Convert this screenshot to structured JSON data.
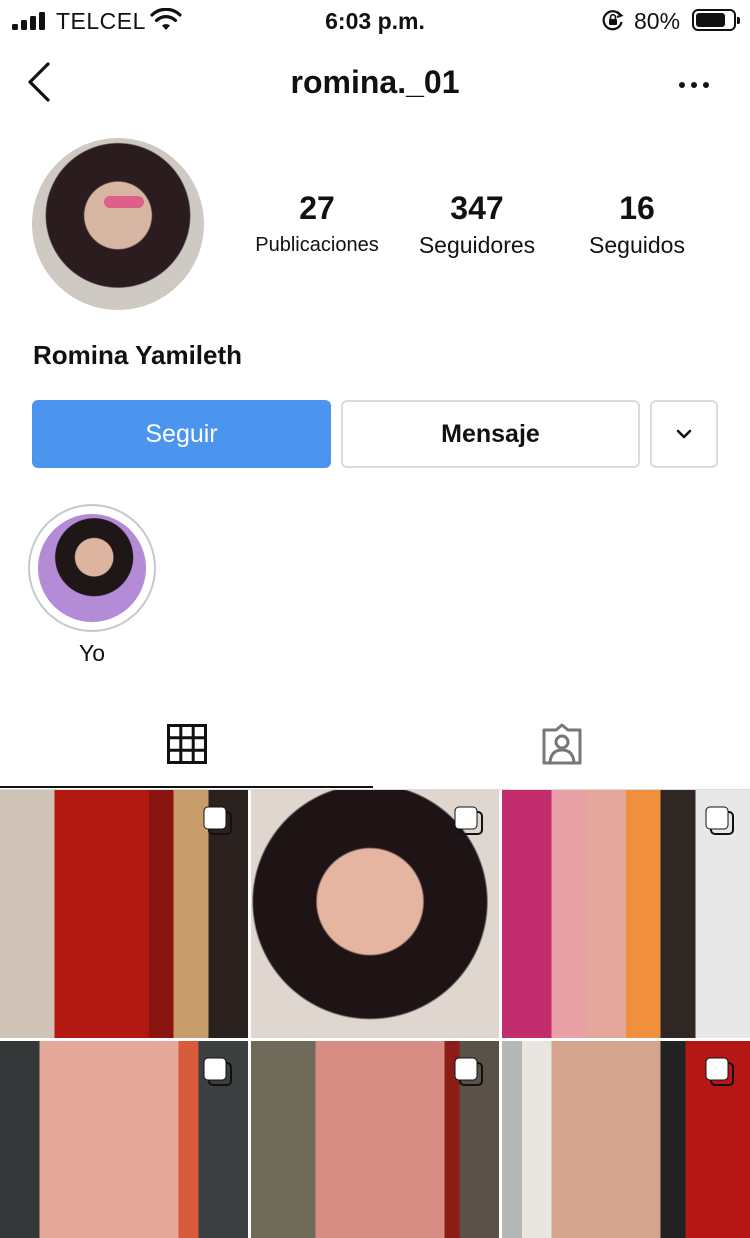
{
  "status_bar": {
    "carrier": "TELCEL",
    "time": "6:03 p.m.",
    "battery_percent": "80%",
    "battery_level": 0.8,
    "icons": [
      "signal-icon",
      "wifi-icon",
      "orientation-lock-icon",
      "battery-icon"
    ]
  },
  "header": {
    "username": "romina._01",
    "icons": [
      "back-chevron-icon",
      "more-options-icon"
    ]
  },
  "profile": {
    "full_name": "Romina Yamileth",
    "stats": [
      {
        "value": "27",
        "label": "Publicaciones"
      },
      {
        "value": "347",
        "label": "Seguidores"
      },
      {
        "value": "16",
        "label": "Seguidos"
      }
    ]
  },
  "actions": {
    "follow_label": "Seguir",
    "message_label": "Mensaje",
    "follow_color": "#4b95ee"
  },
  "highlights": [
    {
      "label": "Yo"
    }
  ],
  "tabs": [
    {
      "name": "grid",
      "icon": "grid-icon",
      "active": true
    },
    {
      "name": "tagged",
      "icon": "tagged-person-icon",
      "active": false
    }
  ],
  "posts": [
    {
      "type": "carousel",
      "icon": "multiple-photos-icon"
    },
    {
      "type": "carousel",
      "icon": "multiple-photos-icon"
    },
    {
      "type": "carousel",
      "icon": "multiple-photos-icon"
    },
    {
      "type": "carousel",
      "icon": "multiple-photos-icon"
    },
    {
      "type": "carousel",
      "icon": "multiple-photos-icon"
    },
    {
      "type": "carousel",
      "icon": "multiple-photos-icon"
    }
  ]
}
